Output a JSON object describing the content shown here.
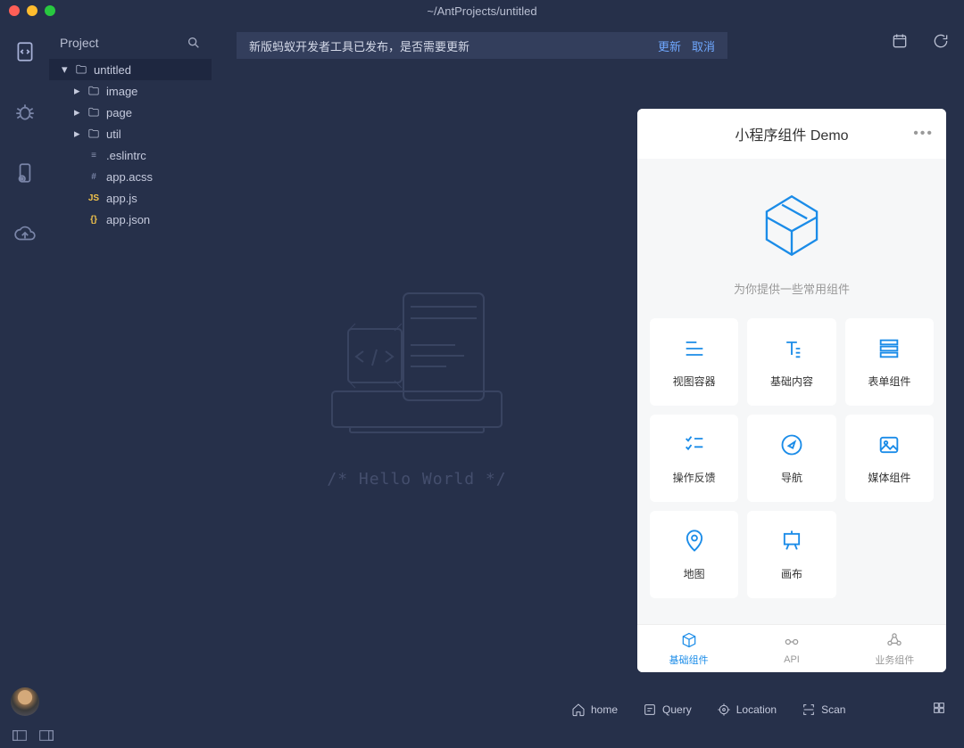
{
  "window": {
    "title": "~/AntProjects/untitled"
  },
  "sidebar": {
    "header": "Project"
  },
  "tree": {
    "root": "untitled",
    "folders": [
      "image",
      "page",
      "util"
    ],
    "files": [
      {
        "name": ".eslintrc",
        "icon": "lines"
      },
      {
        "name": "app.acss",
        "icon": "hash"
      },
      {
        "name": "app.js",
        "icon": "js"
      },
      {
        "name": "app.json",
        "icon": "json"
      }
    ]
  },
  "notification": {
    "text": "新版蚂蚁开发者工具已发布，是否需要更新",
    "update": "更新",
    "cancel": "取消"
  },
  "editor": {
    "hello": "/* Hello World */"
  },
  "preview": {
    "title": "小程序组件 Demo",
    "subtitle": "为你提供一些常用组件",
    "grid": [
      "视图容器",
      "基础内容",
      "表单组件",
      "操作反馈",
      "导航",
      "媒体组件",
      "地图",
      "画布"
    ],
    "tabs": [
      "基础组件",
      "API",
      "业务组件"
    ]
  },
  "bottombar": {
    "items": [
      "home",
      "Query",
      "Location",
      "Scan"
    ]
  }
}
